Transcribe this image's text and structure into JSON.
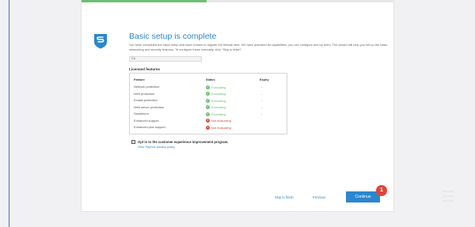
{
  "wizard": {
    "progress_fraction": 0.4,
    "title": "Basic setup is complete",
    "intro": "You have completed the basic setup and have chosen to register the firewall later. We have activated all capabilities, you can configure and try them. The wizard will help you set up the basic networking and security features. To configure these manually, click \"Skip to finish\".",
    "field_value": "Cu",
    "licensed_features_label": "Licensed features"
  },
  "features_table": {
    "headers": {
      "feature": "Feature",
      "status": "Status",
      "expiry": "Expiry"
    },
    "rows": [
      {
        "feature": "Network protection",
        "status": "Evaluating",
        "kind": "ok",
        "expiry": "-"
      },
      {
        "feature": "Web protection",
        "status": "Evaluating",
        "kind": "ok",
        "expiry": "-"
      },
      {
        "feature": "Emails protection",
        "status": "Evaluating",
        "kind": "ok",
        "expiry": "-"
      },
      {
        "feature": "Web server protection",
        "status": "Evaluating",
        "kind": "ok",
        "expiry": "-"
      },
      {
        "feature": "Sandstorm",
        "status": "Evaluating",
        "kind": "ok",
        "expiry": "-"
      },
      {
        "feature": "Enhanced support",
        "status": "Not evaluating",
        "kind": "no",
        "expiry": ""
      },
      {
        "feature": "Enhanced plus support",
        "status": "Not evaluating",
        "kind": "no",
        "expiry": ""
      }
    ]
  },
  "optin": {
    "checked": true,
    "label": "Opt in to the customer experience improvement program.",
    "privacy_link": "View Sophos privacy policy"
  },
  "footer": {
    "skip_label": "Skip to finish",
    "previous_label": "Previous",
    "continue_label": "Continue",
    "badge": "1"
  },
  "colors": {
    "accent": "#2b86cf",
    "success": "#6cbf73",
    "danger": "#e0453a",
    "badge": "#e0453a"
  },
  "icons": {
    "logo": "sophos-shield-icon",
    "ok": "check-circle-icon",
    "no": "x-circle-icon",
    "watermark": "watermark-logo-icon"
  }
}
